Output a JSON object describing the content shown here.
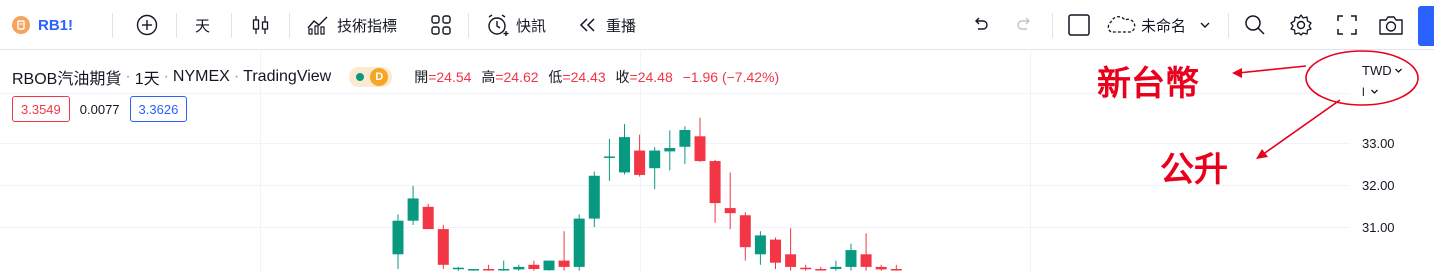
{
  "toolbar": {
    "symbol": "RB1!",
    "interval": "天",
    "indicators_label": "技術指標",
    "alerts_label": "快訊",
    "replay_label": "重播",
    "layout_name": "未命名"
  },
  "legend": {
    "title": "RBOB汽油期貨",
    "interval": "1天",
    "exchange": "NYMEX",
    "source": "TradingView",
    "badge": "D",
    "open_label": "開",
    "open": "=24.54",
    "high_label": "高",
    "high": "=24.62",
    "low_label": "低",
    "low": "=24.43",
    "close_label": "收",
    "close": "=24.48",
    "change": "−1.96 (−7.42%)"
  },
  "prices": {
    "bid": "3.3549",
    "spread": "0.0077",
    "ask": "3.3626"
  },
  "axis": {
    "currency": "TWD",
    "unit": "l",
    "ticks": [
      "33.00",
      "32.00",
      "31.00"
    ]
  },
  "annotations": {
    "currency_note": "新台幣",
    "unit_note": "公升"
  },
  "colors": {
    "up": "#089981",
    "down": "#f23645",
    "accent": "#2962ff",
    "annotation": "#e8001c"
  },
  "chart_data": {
    "type": "candlestick",
    "ylim": [
      30.0,
      33.6
    ],
    "candles": [
      {
        "o": 30.35,
        "h": 31.3,
        "l": 30.0,
        "c": 31.15
      },
      {
        "o": 31.15,
        "h": 31.98,
        "l": 31.05,
        "c": 31.68
      },
      {
        "o": 31.48,
        "h": 31.55,
        "l": 30.95,
        "c": 30.95
      },
      {
        "o": 30.95,
        "h": 31.05,
        "l": 30.0,
        "c": 30.1
      },
      {
        "o": 30.0,
        "h": 30.05,
        "l": 29.96,
        "c": 30.03
      },
      {
        "o": 29.99,
        "h": 30.0,
        "l": 29.96,
        "c": 30.0
      },
      {
        "o": 30.0,
        "h": 30.1,
        "l": 29.96,
        "c": 29.97
      },
      {
        "o": 29.98,
        "h": 30.2,
        "l": 29.96,
        "c": 30.0
      },
      {
        "o": 29.99,
        "h": 30.1,
        "l": 29.96,
        "c": 30.05
      },
      {
        "o": 30.1,
        "h": 30.2,
        "l": 29.96,
        "c": 30.0
      },
      {
        "o": 29.97,
        "h": 30.2,
        "l": 29.96,
        "c": 30.2
      },
      {
        "o": 30.2,
        "h": 30.9,
        "l": 29.96,
        "c": 30.05
      },
      {
        "o": 30.05,
        "h": 31.3,
        "l": 29.96,
        "c": 31.2
      },
      {
        "o": 31.2,
        "h": 32.32,
        "l": 31.0,
        "c": 32.22
      },
      {
        "o": 32.67,
        "h": 33.1,
        "l": 32.1,
        "c": 32.68
      },
      {
        "o": 32.3,
        "h": 33.45,
        "l": 32.25,
        "c": 33.14
      },
      {
        "o": 32.82,
        "h": 33.2,
        "l": 32.2,
        "c": 32.24
      },
      {
        "o": 32.4,
        "h": 32.9,
        "l": 31.9,
        "c": 32.82
      },
      {
        "o": 32.8,
        "h": 33.3,
        "l": 32.35,
        "c": 32.88
      },
      {
        "o": 32.91,
        "h": 33.4,
        "l": 32.5,
        "c": 33.31
      },
      {
        "o": 33.16,
        "h": 33.6,
        "l": 32.55,
        "c": 32.57
      },
      {
        "o": 32.57,
        "h": 32.6,
        "l": 31.1,
        "c": 31.57
      },
      {
        "o": 31.45,
        "h": 32.3,
        "l": 30.95,
        "c": 31.33
      },
      {
        "o": 31.28,
        "h": 31.35,
        "l": 30.2,
        "c": 30.52
      },
      {
        "o": 30.35,
        "h": 30.9,
        "l": 30.1,
        "c": 30.8
      },
      {
        "o": 30.7,
        "h": 30.75,
        "l": 30.0,
        "c": 30.15
      },
      {
        "o": 30.35,
        "h": 30.97,
        "l": 29.96,
        "c": 30.05
      },
      {
        "o": 30.03,
        "h": 30.1,
        "l": 29.96,
        "c": 30.0
      },
      {
        "o": 30.0,
        "h": 30.05,
        "l": 29.96,
        "c": 29.98
      },
      {
        "o": 30.0,
        "h": 30.2,
        "l": 29.96,
        "c": 30.05
      },
      {
        "o": 30.05,
        "h": 30.6,
        "l": 29.96,
        "c": 30.45
      },
      {
        "o": 30.35,
        "h": 30.85,
        "l": 29.96,
        "c": 30.05
      },
      {
        "o": 30.05,
        "h": 30.1,
        "l": 29.96,
        "c": 29.99
      },
      {
        "o": 30.0,
        "h": 30.1,
        "l": 29.96,
        "c": 29.98
      }
    ]
  }
}
